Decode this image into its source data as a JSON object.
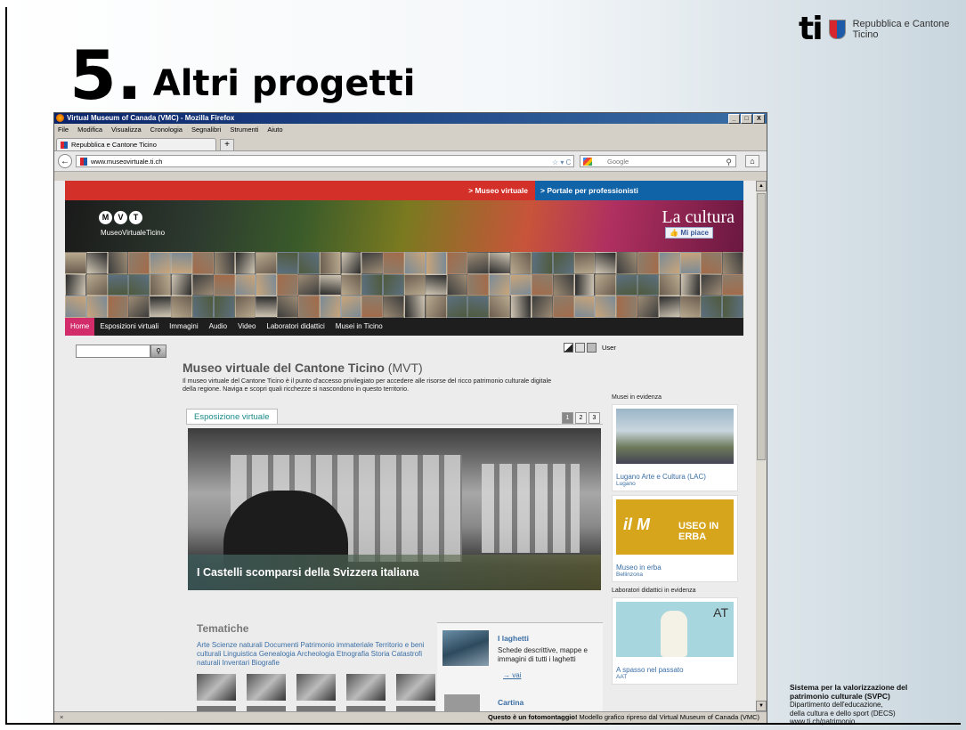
{
  "slide": {
    "number": "5.",
    "title": "Altri progetti",
    "logo_text": "ti",
    "logo_name_line1": "Repubblica e Cantone",
    "logo_name_line2": "Ticino",
    "footer_line1": "Sistema per la valorizzazione del",
    "footer_line2": "patrimonio culturale (SVPC)",
    "footer_line3": "Dipartimento dell'educazione,",
    "footer_line4": "della cultura e dello sport (DECS)",
    "footer_line5": "www.ti.ch/patrimonio"
  },
  "browser": {
    "window_title": "Virtual Museum of Canada (VMC) - Mozilla Firefox",
    "win_buttons": [
      "_",
      "□",
      "X"
    ],
    "menu": [
      "File",
      "Modifica",
      "Visualizza",
      "Cronologia",
      "Segnalibri",
      "Strumenti",
      "Aiuto"
    ],
    "tab_title": "Repubblica e Cantone Ticino",
    "new_tab": "+",
    "url": "www.museovirtuale.ti.ch",
    "search_placeholder": "Google",
    "status_close": "×",
    "status_bold": "Questo è un fotomontaggio!",
    "status_rest": " Modello grafico ripreso dal Virtual Museum of Canada (VMC)"
  },
  "site": {
    "top_link_1": "> Museo virtuale",
    "top_link_2": "> Portale per professionisti",
    "mvt_letters": [
      "M",
      "V",
      "T"
    ],
    "mvt_name": "MuseoVirtualeTicino",
    "banner_text": "La cultura",
    "like_text": "Mi piace",
    "nav": [
      "Home",
      "Esposizioni virtuali",
      "Immagini",
      "Audio",
      "Video",
      "Laboratori didattici",
      "Musei in Ticino"
    ],
    "user_label": "User",
    "main_title": "Museo virtuale del Cantone Ticino",
    "main_title_abbr": " (MVT)",
    "intro": "Il museo virtuale del Cantone Ticino è il punto d'accesso privilegiato per accedere alle risorse del ricco patrimonio culturale digitale della regione. Naviga e scopri quali ricchezze si nascondono in questo territorio.",
    "expo_tab": "Esposizione virtuale",
    "pager": [
      "1",
      "2",
      "3"
    ],
    "expo_caption": "I Castelli scomparsi della Svizzera italiana",
    "tematiche_title": "Tematiche",
    "tematiche_links": "Arte  Scienze naturali  Documenti  Patrimonio immateriale  Territorio e beni culturali  Linguistica  Genealogia  Archeologia  Etnografia  Storia  Catastrofi naturali  Inventari  Biografie",
    "laghetti_title": "I laghetti",
    "laghetti_desc": "Schede descrittive, mappe e immagini di tutti i laghetti",
    "laghetti_vai": "→ vai",
    "cartina_title": "Cartina",
    "musei_label": "Musei in evidenza",
    "lac_name": "Lugano Arte e Cultura (LAC)",
    "lac_place": "Lugano",
    "erba_logo": "il M",
    "erba_logo2": "USEO IN ERBA",
    "erba_name": "Museo in erba",
    "erba_place": "Bellinzona",
    "lab_label": "Laboratori didattici in evidenza",
    "aat_logo": "AT",
    "aat_name": "A spasso nel passato",
    "aat_place": "AAT"
  },
  "colors": {
    "red": "#d3302a",
    "blue": "#1163a8",
    "nav_active": "#d22c6a",
    "link": "#3a6ea5"
  }
}
